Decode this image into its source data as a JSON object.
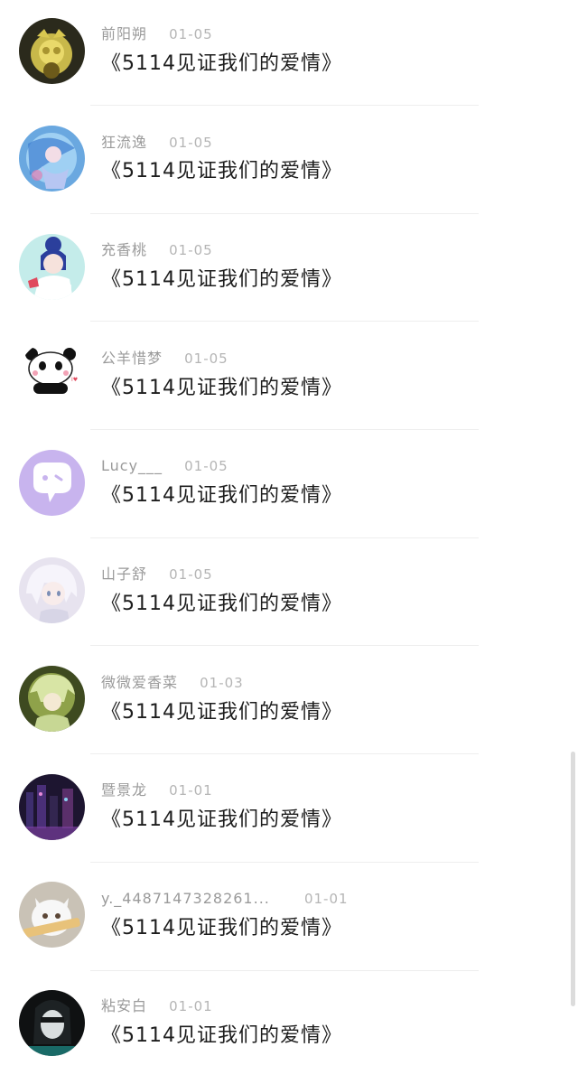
{
  "comments": [
    {
      "name": "前阳朔",
      "date": "01-05",
      "message": "《5114见证我们的爱情》",
      "avatar_icon": "yellow-flower-avatar"
    },
    {
      "name": "狂流逸",
      "date": "01-05",
      "message": "《5114见证我们的爱情》",
      "avatar_icon": "blue-anime-avatar"
    },
    {
      "name": "充香桃",
      "date": "01-05",
      "message": "《5114见证我们的爱情》",
      "avatar_icon": "girl-blue-hair-avatar"
    },
    {
      "name": "公羊惜梦",
      "date": "01-05",
      "message": "《5114见证我们的爱情》",
      "avatar_icon": "panda-avatar"
    },
    {
      "name": "Lucy___",
      "date": "01-05",
      "message": "《5114见证我们的爱情》",
      "avatar_icon": "purple-chat-bubble-avatar"
    },
    {
      "name": "山子舒",
      "date": "01-05",
      "message": "《5114见证我们的爱情》",
      "avatar_icon": "white-hair-anime-avatar"
    },
    {
      "name": "微微爱香菜",
      "date": "01-03",
      "message": "《5114见证我们的爱情》",
      "avatar_icon": "green-anime-avatar"
    },
    {
      "name": "暨景龙",
      "date": "01-01",
      "message": "《5114见证我们的爱情》",
      "avatar_icon": "night-city-avatar"
    },
    {
      "name": "y._4487147328261...",
      "date": "01-01",
      "message": "《5114见证我们的爱情》",
      "avatar_icon": "white-cat-avatar"
    },
    {
      "name": "粘安白",
      "date": "01-01",
      "message": "《5114见证我们的爱情》",
      "avatar_icon": "dark-portrait-avatar"
    }
  ],
  "colors": {
    "name_text": "#9a9a9a",
    "date_text": "#b5b5b5",
    "message_text": "#1d1d1d",
    "divider": "#eeeeee"
  }
}
